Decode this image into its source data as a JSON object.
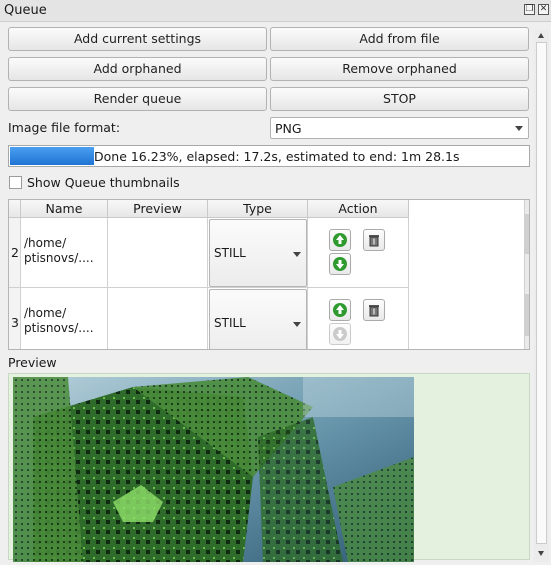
{
  "window": {
    "title": "Queue"
  },
  "buttons": {
    "add_current_settings": "Add current settings",
    "add_from_file": "Add from file",
    "add_orphaned": "Add orphaned",
    "remove_orphaned": "Remove orphaned",
    "render_queue": "Render queue",
    "stop": "STOP"
  },
  "image_format": {
    "label": "Image file format:",
    "value": "PNG"
  },
  "progress": {
    "percent": 16.23,
    "text": "Done 16.23%, elapsed: 17.2s, estimated to end: 1m 28.1s"
  },
  "thumbnails_option": {
    "label": "Show Queue thumbnails",
    "checked": false
  },
  "table": {
    "columns": [
      "Name",
      "Preview",
      "Type",
      "Action"
    ],
    "rows": [
      {
        "index": "2",
        "name": "/home/\nptisnovs/....",
        "type": "STILL",
        "up_enabled": true,
        "down_enabled": true
      },
      {
        "index": "3",
        "name": "/home/\nptisnovs/....",
        "type": "STILL",
        "up_enabled": true,
        "down_enabled": false
      }
    ]
  },
  "preview": {
    "label": "Preview"
  },
  "icons": {
    "float": "float-icon",
    "close": "close-icon",
    "move_up": "arrow-up-icon",
    "move_down": "arrow-down-icon",
    "delete": "trash-icon"
  },
  "colors": {
    "progress": "#1f74d4",
    "arrow_green": "#2f9a2f",
    "preview_bg": "#e4f1df"
  }
}
